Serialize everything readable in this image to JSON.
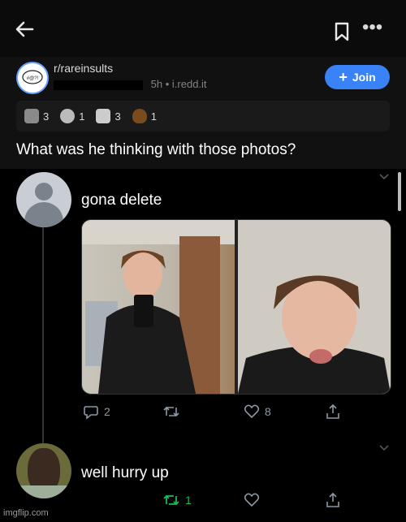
{
  "nav": {
    "back_icon": "arrow-left-icon",
    "save_icon": "bookmark-icon",
    "more_label": "•••"
  },
  "post": {
    "subreddit": "r/rareinsults",
    "age": "5h",
    "separator": "•",
    "domain": "i.redd.it",
    "join_label": "Join",
    "title": "What was he thinking with those photos?"
  },
  "awards": [
    {
      "count": "3",
      "icon": "hands-award-icon"
    },
    {
      "count": "1",
      "icon": "wholesome-award-icon"
    },
    {
      "count": "3",
      "icon": "silver-award-icon"
    },
    {
      "count": "1",
      "icon": "poop-award-icon"
    }
  ],
  "tweet1": {
    "text": "gona delete",
    "replies": "2",
    "retweets": "",
    "likes": "8"
  },
  "tweet2": {
    "text": "well hurry up",
    "replies": "",
    "retweets": "1",
    "likes": ""
  },
  "watermark": "imgflip.com",
  "colors": {
    "join_bg": "#3a82f7",
    "retweet_active": "#1db954"
  }
}
